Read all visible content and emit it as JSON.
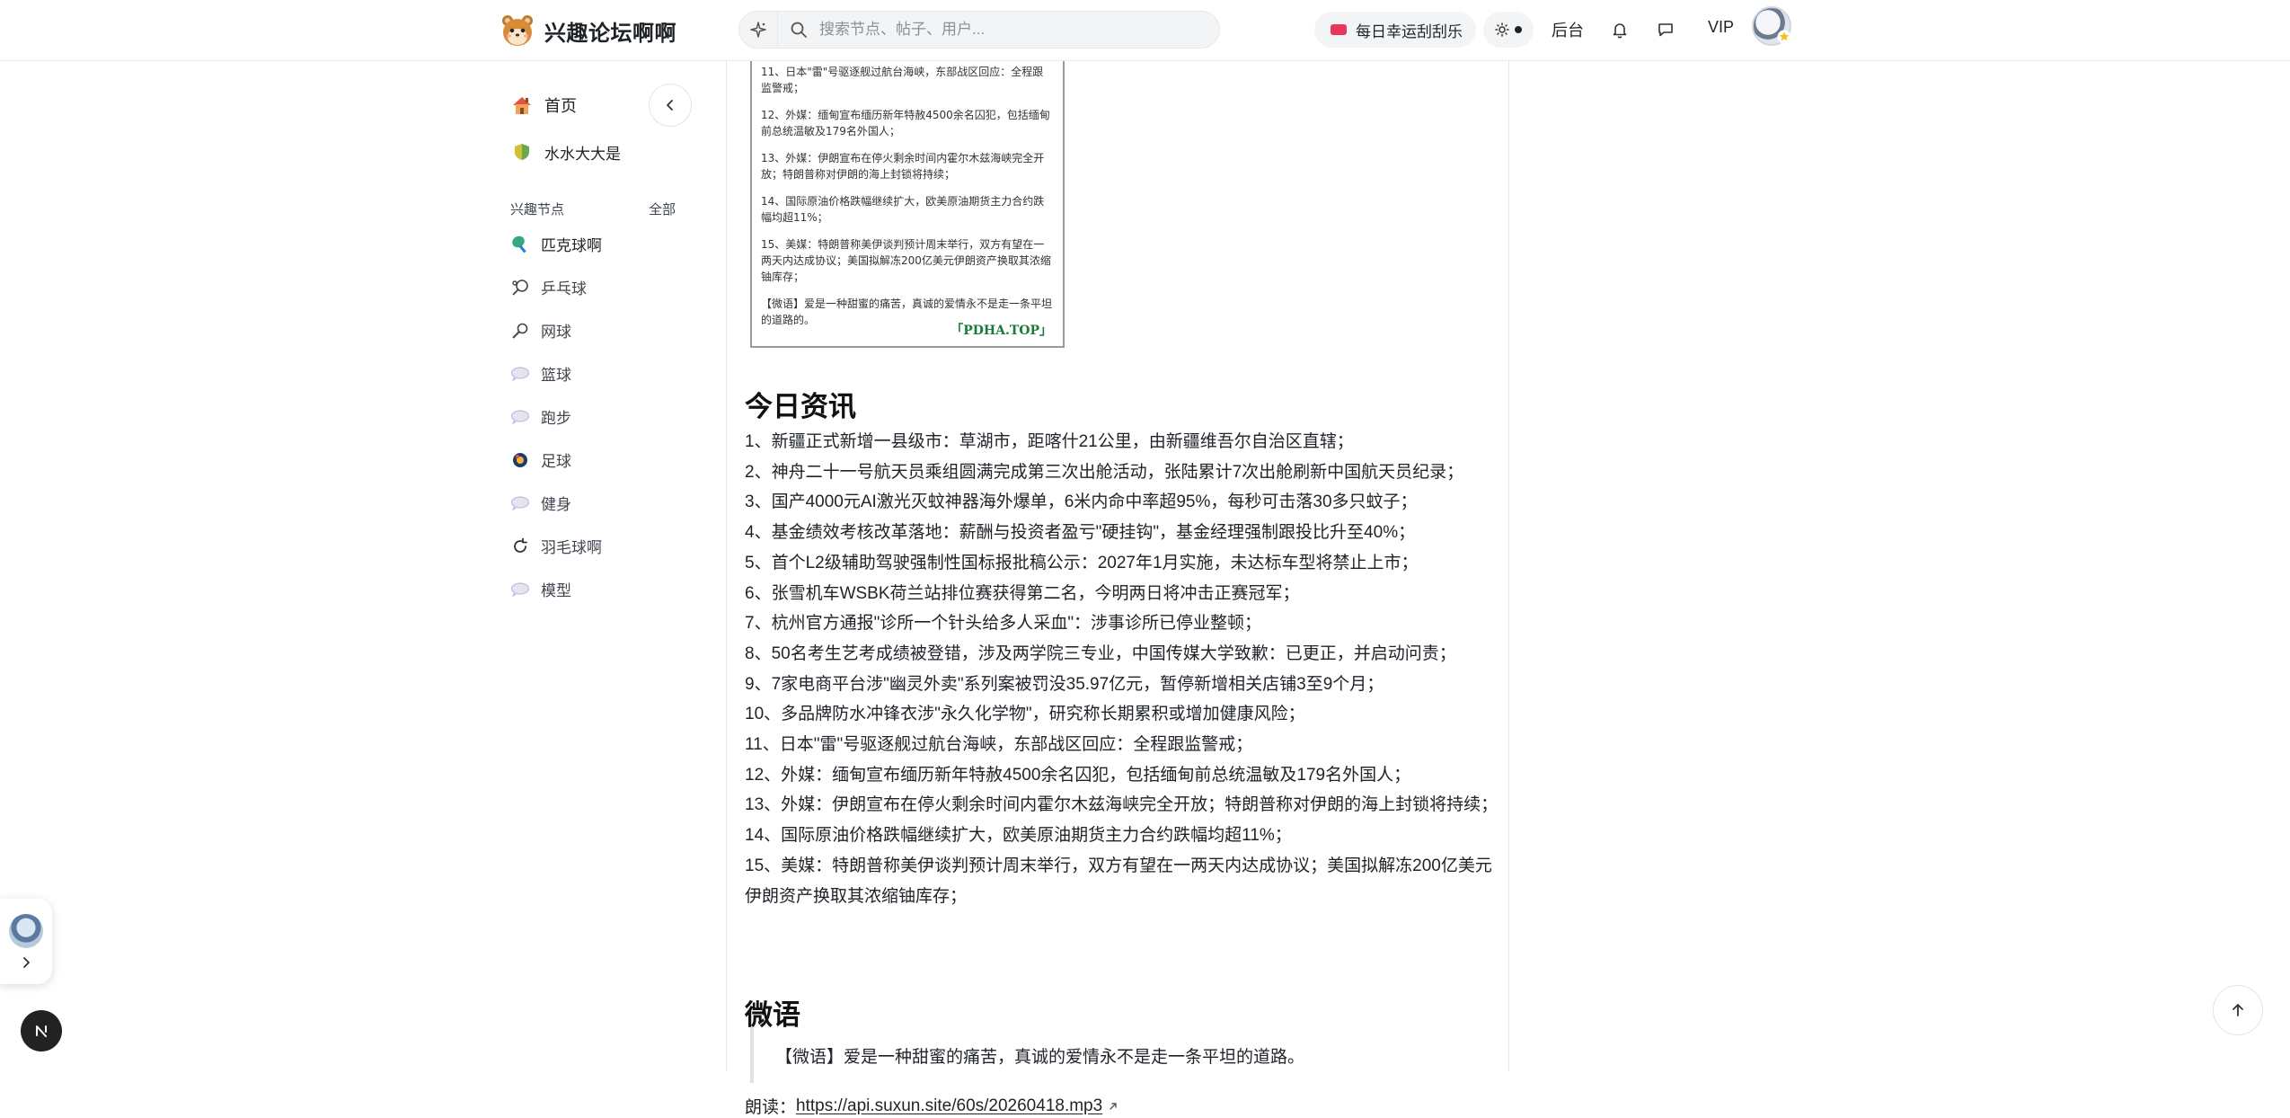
{
  "header": {
    "site_name": "兴趣论坛啊啊",
    "search_placeholder": "搜索节点、帖子、用户...",
    "checkin_label": "每日幸运刮刮乐",
    "admin_label": "后台",
    "vip_label": "VIP",
    "icons": [
      "hamster-logo-icon",
      "sparkle-icon",
      "search-icon",
      "ticket-icon",
      "sun-icon",
      "bell-icon",
      "message-icon",
      "avatar"
    ]
  },
  "sidebar": {
    "home_label": "首页",
    "water_label": "水水大大是",
    "section_title": "兴趣节点",
    "section_all": "全部",
    "nodes": [
      {
        "label": "匹克球啊",
        "icon": "paddle-icon"
      },
      {
        "label": "乒乓球",
        "icon": "table-tennis-icon"
      },
      {
        "label": "网球",
        "icon": "racket-icon"
      },
      {
        "label": "篮球",
        "icon": "chat-bubble-icon"
      },
      {
        "label": "跑步",
        "icon": "chat-bubble-icon"
      },
      {
        "label": "足球",
        "icon": "soccer-ball-icon"
      },
      {
        "label": "健身",
        "icon": "chat-bubble-icon"
      },
      {
        "label": "羽毛球啊",
        "icon": "refresh-icon"
      },
      {
        "label": "模型",
        "icon": "chat-bubble-icon"
      }
    ]
  },
  "poster": {
    "lines": [
      "11、日本\"雷\"号驱逐舰过航台海峡，东部战区回应：全程跟监警戒；",
      "12、外媒：缅甸宣布缅历新年特赦4500余名囚犯，包括缅甸前总统温敏及179名外国人；",
      "13、外媒：伊朗宣布在停火剩余时间内霍尔木兹海峡完全开放；特朗普称对伊朗的海上封锁将持续；",
      "14、国际原油价格跌幅继续扩大，欧美原油期货主力合约跌幅均超11%；",
      "15、美媒：特朗普称美伊谈判预计周末举行，双方有望在一两天内达成协议；美国拟解冻200亿美元伊朗资产换取其浓缩铀库存；",
      "【微语】爱是一种甜蜜的痛苦，真诚的爱情永不是走一条平坦的道路的。"
    ],
    "brand": "「PDHA.TOP」"
  },
  "article": {
    "news_heading": "今日资讯",
    "news": [
      "1、新疆正式新增一县级市：草湖市，距喀什21公里，由新疆维吾尔自治区直辖；",
      "2、神舟二十一号航天员乘组圆满完成第三次出舱活动，张陆累计7次出舱刷新中国航天员纪录；",
      "3、国产4000元AI激光灭蚊神器海外爆单，6米内命中率超95%，每秒可击落30多只蚊子；",
      "4、基金绩效考核改革落地：薪酬与投资者盈亏\"硬挂钩\"，基金经理强制跟投比升至40%；",
      "5、首个L2级辅助驾驶强制性国标报批稿公示：2027年1月实施，未达标车型将禁止上市；",
      "6、张雪机车WSBK荷兰站排位赛获得第二名，今明两日将冲击正赛冠军；",
      "7、杭州官方通报\"诊所一个针头给多人采血\"：涉事诊所已停业整顿；",
      "8、50名考生艺考成绩被登错，涉及两学院三专业，中国传媒大学致歉：已更正，并启动问责；",
      "9、7家电商平台涉\"幽灵外卖\"系列案被罚没35.97亿元，暂停新增相关店铺3至9个月；",
      "10、多品牌防水冲锋衣涉\"永久化学物\"，研究称长期累积或增加健康风险；",
      "11、日本\"雷\"号驱逐舰过航台海峡，东部战区回应：全程跟监警戒；",
      "12、外媒：缅甸宣布缅历新年特赦4500余名囚犯，包括缅甸前总统温敏及179名外国人；",
      "13、外媒：伊朗宣布在停火剩余时间内霍尔木兹海峡完全开放；特朗普称对伊朗的海上封锁将持续；",
      "14、国际原油价格跌幅继续扩大，欧美原油期货主力合约跌幅均超11%；",
      "15、美媒：特朗普称美伊谈判预计周末举行，双方有望在一两天内达成协议；美国拟解冻200亿美元伊朗资产换取其浓缩铀库存；"
    ],
    "quote_heading": "微语",
    "quote": "【微语】爱是一种甜蜜的痛苦，真诚的爱情永不是走一条平坦的道路。",
    "listen_label": "朗读：",
    "listen_url": "https://api.suxun.site/60s/20260418.mp3"
  }
}
